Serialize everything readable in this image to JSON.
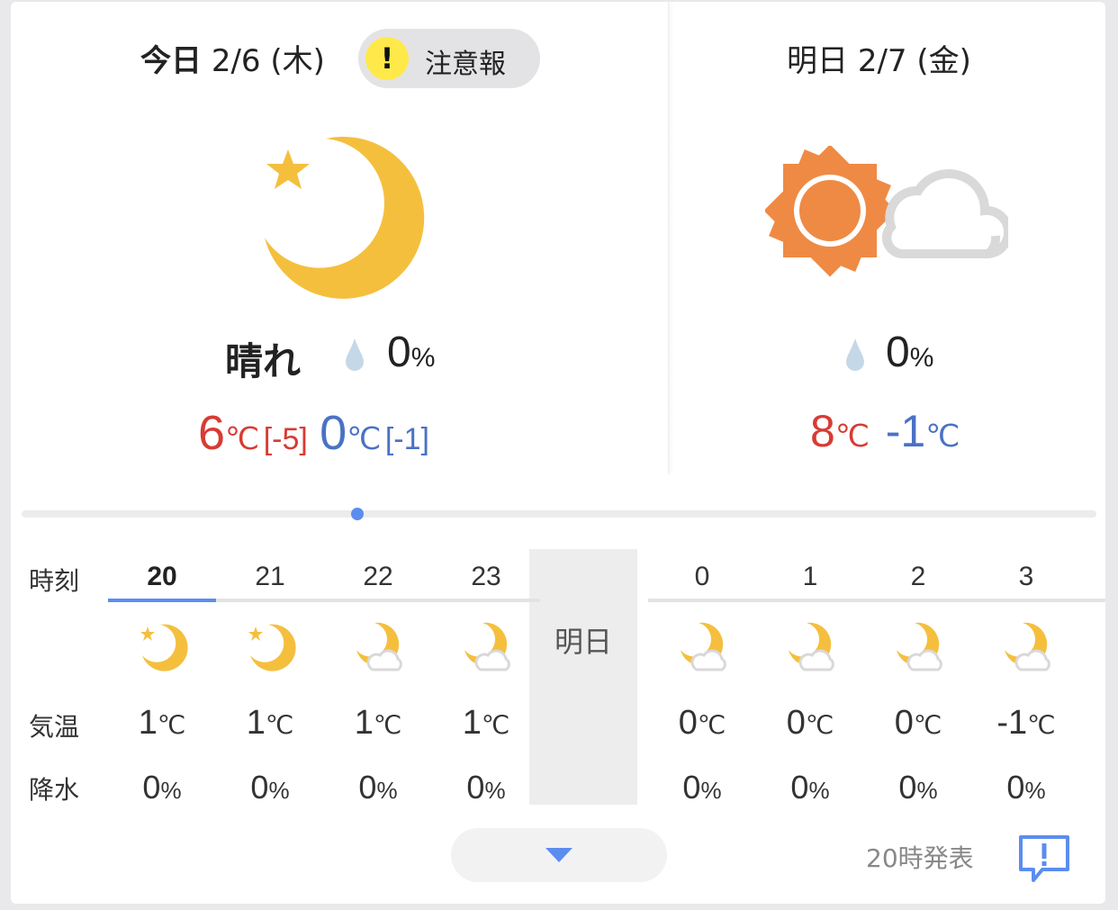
{
  "today": {
    "title": "今日",
    "date": "2/6 (木)",
    "warning": "注意報",
    "warning_mark": "!",
    "condition": "晴れ",
    "pop": "0",
    "pop_unit": "%",
    "high": "6",
    "high_unit": "℃",
    "high_diff": "[-5]",
    "low": "0",
    "low_unit": "℃",
    "low_diff": "[-1]",
    "icon": "moon-star-icon"
  },
  "tomorrow": {
    "title": "明日",
    "date": "2/7 (金)",
    "pop": "0",
    "pop_unit": "%",
    "high": "8",
    "high_unit": "℃",
    "low": "-1",
    "low_unit": "℃",
    "icon": "sun-cloud-icon"
  },
  "hourly": {
    "label_time": "時刻",
    "label_temp": "気温",
    "label_pop": "降水",
    "tomorrow_label": "明日",
    "temp_unit": "℃",
    "pop_unit": "%",
    "today_hours": [
      {
        "hour": "20",
        "temp": "1",
        "pop": "0",
        "icon": "moon-star-icon"
      },
      {
        "hour": "21",
        "temp": "1",
        "pop": "0",
        "icon": "moon-star-icon"
      },
      {
        "hour": "22",
        "temp": "1",
        "pop": "0",
        "icon": "moon-cloud-icon"
      },
      {
        "hour": "23",
        "temp": "1",
        "pop": "0",
        "icon": "moon-cloud-icon"
      }
    ],
    "tomorrow_hours": [
      {
        "hour": "0",
        "temp": "0",
        "pop": "0",
        "icon": "moon-cloud-icon"
      },
      {
        "hour": "1",
        "temp": "0",
        "pop": "0",
        "icon": "moon-cloud-icon"
      },
      {
        "hour": "2",
        "temp": "0",
        "pop": "0",
        "icon": "moon-cloud-icon"
      },
      {
        "hour": "3",
        "temp": "-1",
        "pop": "0",
        "icon": "moon-cloud-icon"
      }
    ]
  },
  "footer": {
    "issued": "20時発表",
    "expand_icon": "chevron-down-icon",
    "feedback_icon": "feedback-icon"
  },
  "colors": {
    "accent": "#5b8def",
    "high": "#d83b33",
    "low": "#4a72c4",
    "moon": "#f5bf3e",
    "sun": "#ef8a44",
    "cloud": "#d9d9d9",
    "warning": "#ffe94a"
  }
}
